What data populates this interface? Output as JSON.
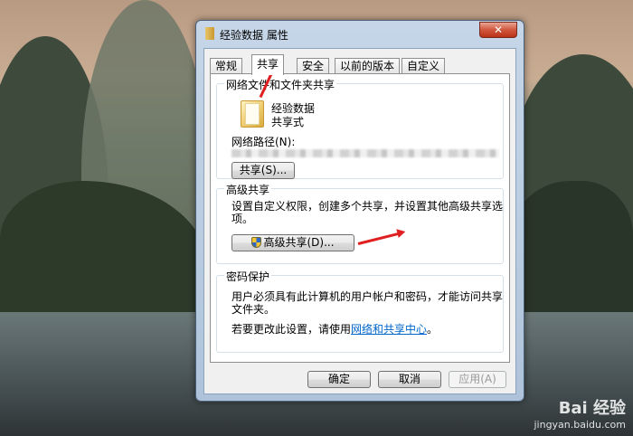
{
  "window": {
    "title": "经验数据 属性",
    "close_label": "✕"
  },
  "tabs": [
    {
      "label": "常规",
      "active": false
    },
    {
      "label": "共享",
      "active": true
    },
    {
      "label": "安全",
      "active": false
    },
    {
      "label": "以前的版本",
      "active": false
    },
    {
      "label": "自定义",
      "active": false
    }
  ],
  "network_share": {
    "legend": "网络文件和文件夹共享",
    "folder_name": "经验数据",
    "share_status": "共享式",
    "path_label": "网络路径(N):",
    "share_button": "共享(S)..."
  },
  "advanced_share": {
    "legend": "高级共享",
    "description_line1": "设置自定义权限，创建多个共享，并设置其他高级共享选",
    "description_line2": "项。",
    "button": "高级共享(D)..."
  },
  "password_protection": {
    "legend": "密码保护",
    "description_line1": "用户必须具有此计算机的用户帐户和密码，才能访问共享",
    "description_line2": "文件夹。",
    "change_prefix": "若要更改此设置，请使用",
    "link_text": "网络和共享中心",
    "change_suffix": "。"
  },
  "footer": {
    "ok": "确定",
    "cancel": "取消",
    "apply": "应用(A)"
  },
  "watermark": {
    "logo": "Bai 经验",
    "url": "jingyan.baidu.com"
  },
  "colors": {
    "annotation_arrow": "#e02020",
    "link": "#0066cc",
    "close_button": "#c8462c"
  }
}
